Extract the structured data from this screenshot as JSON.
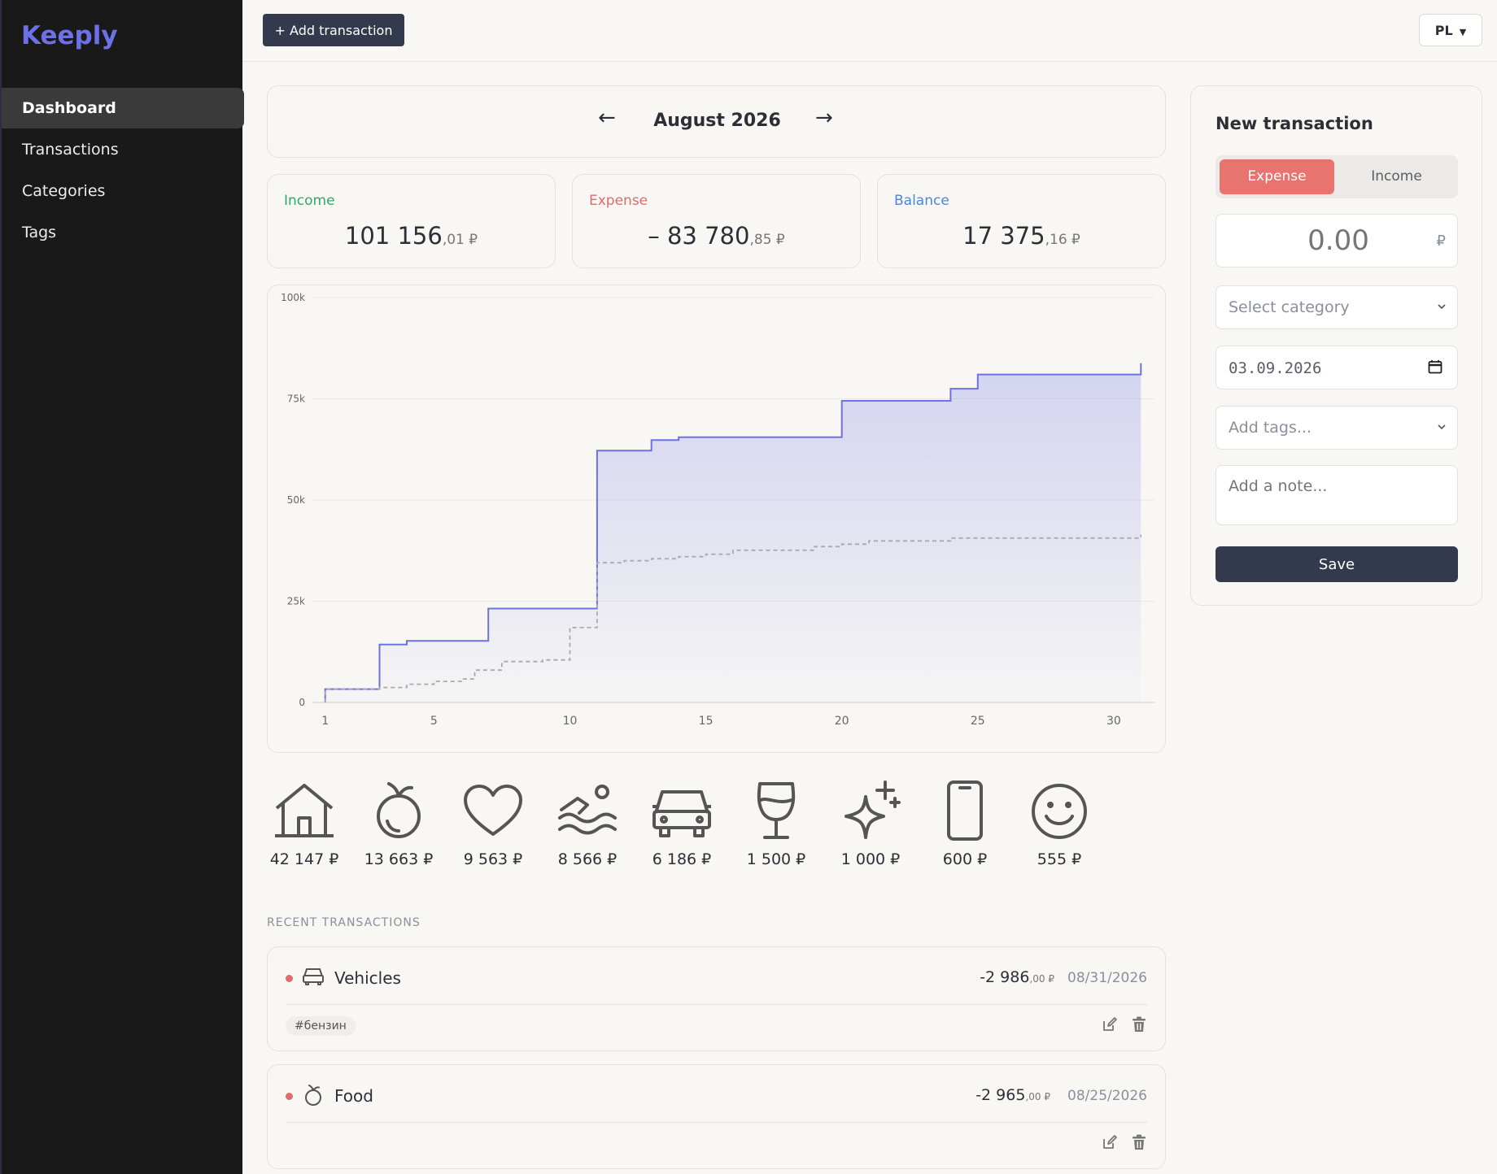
{
  "app": {
    "name": "Keeply"
  },
  "sidebar": {
    "items": [
      {
        "label": "Dashboard",
        "active": true
      },
      {
        "label": "Transactions"
      },
      {
        "label": "Categories"
      },
      {
        "label": "Tags"
      }
    ]
  },
  "topbar": {
    "add_label": "+ Add transaction",
    "lang": "PL",
    "lang_caret": "▼"
  },
  "month": {
    "prev": "←",
    "title": "August 2026",
    "next": "→"
  },
  "summary": {
    "income": {
      "label": "Income",
      "main": "101 156",
      "cents": ",01 ₽"
    },
    "expense": {
      "label": "Expense",
      "main": "– 83 780",
      "cents": ",85 ₽"
    },
    "balance": {
      "label": "Balance",
      "main": "17 375",
      "cents": ",16 ₽"
    }
  },
  "colors": {
    "accent": "#6c72e6",
    "income": "#2fa86b",
    "expense": "#e06b6b",
    "balance": "#4c88d8",
    "dark": "#343a4e"
  },
  "chart_data": {
    "type": "line",
    "ylim": [
      0,
      100000
    ],
    "xlim": [
      0.5,
      31.5
    ],
    "yticks": [
      {
        "v": 0,
        "label": "0"
      },
      {
        "v": 25000,
        "label": "25k"
      },
      {
        "v": 50000,
        "label": "50k"
      },
      {
        "v": 75000,
        "label": "75k"
      },
      {
        "v": 100000,
        "label": "100k"
      }
    ],
    "xticks": [
      1,
      5,
      10,
      15,
      20,
      25,
      30
    ],
    "grid": true,
    "series": [
      {
        "style": "solid-step-area",
        "color": "#6c72e6",
        "points": [
          [
            1,
            0
          ],
          [
            1,
            3300
          ],
          [
            3,
            3300
          ],
          [
            3,
            14300
          ],
          [
            4,
            14300
          ],
          [
            4,
            15200
          ],
          [
            7,
            15200
          ],
          [
            7,
            23200
          ],
          [
            11,
            23200
          ],
          [
            11,
            62200
          ],
          [
            13,
            62200
          ],
          [
            13,
            64800
          ],
          [
            14,
            64800
          ],
          [
            14,
            65500
          ],
          [
            20,
            65500
          ],
          [
            20,
            74500
          ],
          [
            24,
            74500
          ],
          [
            24,
            77500
          ],
          [
            25,
            77500
          ],
          [
            25,
            81000
          ],
          [
            31,
            81000
          ],
          [
            31,
            83800
          ]
        ]
      },
      {
        "style": "dashed",
        "color": "#a8aab2",
        "points": [
          [
            1,
            0
          ],
          [
            1,
            3300
          ],
          [
            3,
            3300
          ],
          [
            3,
            3700
          ],
          [
            4,
            3700
          ],
          [
            4,
            4500
          ],
          [
            5,
            4500
          ],
          [
            5,
            5200
          ],
          [
            6,
            5200
          ],
          [
            6,
            5800
          ],
          [
            6.5,
            5800
          ],
          [
            6.5,
            8000
          ],
          [
            7.5,
            8000
          ],
          [
            7.5,
            10100
          ],
          [
            9,
            10100
          ],
          [
            9,
            10500
          ],
          [
            10,
            10500
          ],
          [
            10,
            18500
          ],
          [
            11,
            18500
          ],
          [
            11,
            34500
          ],
          [
            12,
            34500
          ],
          [
            12,
            35000
          ],
          [
            13,
            35000
          ],
          [
            13,
            35500
          ],
          [
            14,
            35500
          ],
          [
            14,
            36000
          ],
          [
            15,
            36000
          ],
          [
            15,
            36600
          ],
          [
            16,
            36600
          ],
          [
            16,
            37600
          ],
          [
            19,
            37600
          ],
          [
            19,
            38500
          ],
          [
            20,
            38500
          ],
          [
            20,
            39100
          ],
          [
            21,
            39100
          ],
          [
            21,
            39900
          ],
          [
            24,
            39900
          ],
          [
            24,
            40600
          ],
          [
            31,
            40600
          ],
          [
            31,
            41400
          ]
        ]
      }
    ]
  },
  "categories": [
    {
      "icon": "house-icon",
      "amount": "42 147 ₽"
    },
    {
      "icon": "apple-icon",
      "amount": "13 663 ₽"
    },
    {
      "icon": "heart-icon",
      "amount": "9 563 ₽"
    },
    {
      "icon": "swimmer-icon",
      "amount": "8 566 ₽"
    },
    {
      "icon": "car-icon",
      "amount": "6 186 ₽"
    },
    {
      "icon": "wine-glass-icon",
      "amount": "1 500 ₽"
    },
    {
      "icon": "sparkle-icon",
      "amount": "1 000 ₽"
    },
    {
      "icon": "phone-icon",
      "amount": "600 ₽"
    },
    {
      "icon": "smiley-icon",
      "amount": "555 ₽"
    }
  ],
  "recent": {
    "title": "RECENT TRANSACTIONS",
    "items": [
      {
        "icon": "car-icon",
        "name": "Vehicles",
        "amount_main": "-2 986",
        "amount_cents": ",00 ₽",
        "date": "08/31/2026",
        "tag": "#бензин"
      },
      {
        "icon": "apple-icon",
        "name": "Food",
        "amount_main": "-2 965",
        "amount_cents": ",00 ₽",
        "date": "08/25/2026"
      }
    ]
  },
  "form": {
    "title": "New transaction",
    "expense_label": "Expense",
    "income_label": "Income",
    "amount_placeholder": "0.00",
    "currency": "₽",
    "category_placeholder": "Select category",
    "date_value": "03.09.2026",
    "tags_placeholder": "Add tags...",
    "note_placeholder": "Add a note...",
    "save_label": "Save"
  }
}
